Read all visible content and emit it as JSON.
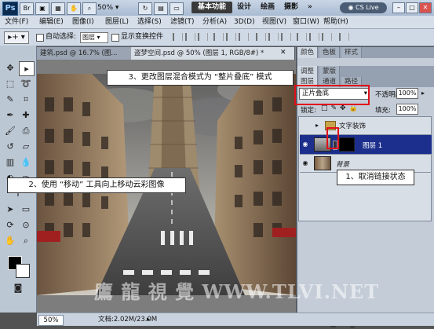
{
  "appbar": {
    "logo": "Ps",
    "zoom": "50%",
    "workspaces": [
      "基本功能",
      "设计",
      "绘画",
      "摄影"
    ],
    "more": "»",
    "cs_live": "CS Live"
  },
  "menu": [
    "文件(F)",
    "编辑(E)",
    "图像(I)",
    "图层(L)",
    "选择(S)",
    "滤镜(T)",
    "分析(A)",
    "3D(D)",
    "视图(V)",
    "窗口(W)",
    "帮助(H)"
  ],
  "options": {
    "auto_select_label": "自动选择:",
    "auto_select_value": "图层",
    "show_transform_label": "显示变换控件"
  },
  "doc_tabs": [
    {
      "label": "建筑.psd @ 16.7% (图..."
    },
    {
      "label": "盗梦空间.psd @ 50% (图层 1, RGB/8#) *"
    }
  ],
  "status": {
    "zoom": "50%",
    "doc_size": "文档:2.02M/23.0M"
  },
  "panel": {
    "top_tabs": [
      "颜色",
      "色板",
      "样式"
    ],
    "second_tabs": [
      "调整",
      "蒙版"
    ],
    "layer_tabs": [
      "图层",
      "通道",
      "路径"
    ],
    "blend_mode": "正片叠底",
    "opacity_label": "不透明度:",
    "opacity_value": "100%",
    "lock_label": "锁定:",
    "fill_label": "填充:",
    "fill_value": "100%",
    "layers": [
      {
        "name": "文字装饰",
        "type": "group"
      },
      {
        "name": "图层 1",
        "type": "layer",
        "selected": true
      },
      {
        "name": "背景",
        "type": "background"
      }
    ],
    "footer_icons": [
      "link-icon",
      "fx-icon",
      "mask-icon",
      "adjustment-icon",
      "folder-icon",
      "new-layer-icon",
      "trash-icon"
    ]
  },
  "callouts": {
    "step1": "1、取消链接状态",
    "step2": "2、使用 “移动” 工具向上移动云彩图像",
    "step3": "3、更改图层混合模式为 “整片叠底” 模式"
  },
  "watermark": "鷹 龍 視 覺  WWW.TLVI.NET",
  "colors": {
    "highlight": "#e0101a",
    "selected_layer": "#1c2f8c"
  }
}
